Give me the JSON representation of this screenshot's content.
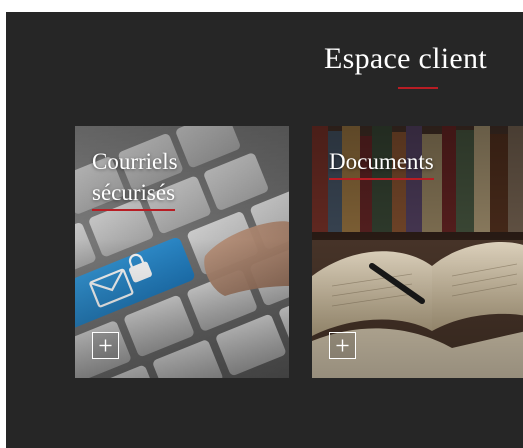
{
  "header": {
    "title": "Espace client"
  },
  "cards": [
    {
      "title_line1": "Courriels",
      "title_line2": "sécurisés",
      "button_icon": "plus-icon",
      "image": "keyboard-envelope-lock-key"
    },
    {
      "title_line1": "Documents",
      "button_icon": "plus-icon",
      "image": "open-books-library"
    }
  ],
  "colors": {
    "background": "#262626",
    "accent": "#b81d24",
    "text": "#ffffff",
    "email_key": "#2a8fd0"
  }
}
